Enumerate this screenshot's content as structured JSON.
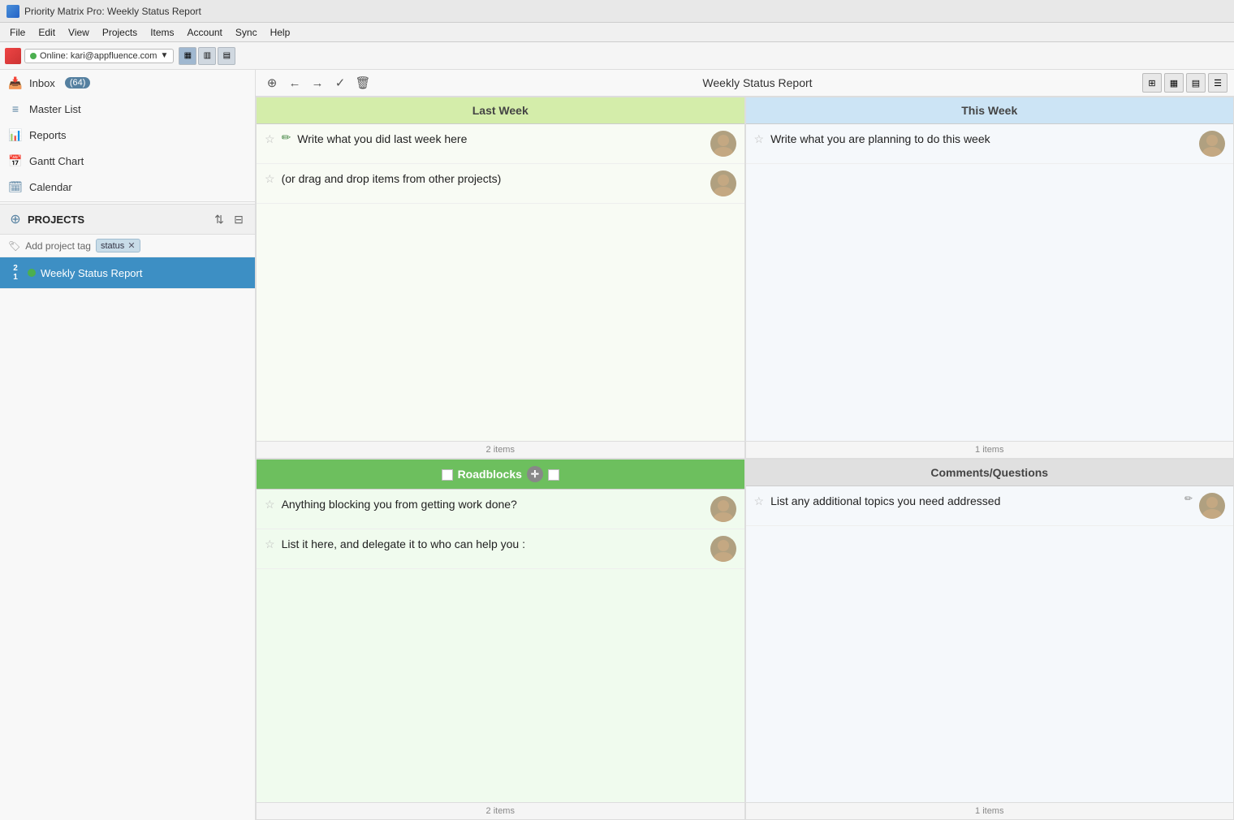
{
  "titlebar": {
    "app_icon": "pm-icon",
    "title": "Priority Matrix Pro: Weekly Status Report"
  },
  "menubar": {
    "items": [
      "File",
      "Edit",
      "View",
      "Projects",
      "Items",
      "Account",
      "Sync",
      "Help"
    ]
  },
  "toolbar": {
    "online_label": "Online: kari@appfluence.com",
    "dropdown_arrow": "▼"
  },
  "sidebar": {
    "inbox_label": "Inbox",
    "inbox_count": "(64)",
    "master_list_label": "Master List",
    "reports_label": "Reports",
    "gantt_label": "Gantt Chart",
    "calendar_label": "Calendar",
    "projects_label": "PROJECTS",
    "add_project_tag_label": "Add project tag",
    "tag_name": "status",
    "tag_x": "✕",
    "project": {
      "name": "Weekly Status Report",
      "num_top": "2",
      "num_bottom": "1"
    }
  },
  "report": {
    "title": "Weekly Status Report",
    "quadrants": {
      "last_week": {
        "header": "Last Week",
        "items": [
          {
            "star": "☆",
            "pencil": "✏",
            "text": "Write what you did last week here",
            "has_avatar": true
          },
          {
            "star": "☆",
            "text": "(or drag and drop items from other projects)",
            "has_avatar": true
          }
        ],
        "footer_count": "2 items"
      },
      "this_week": {
        "header": "This Week",
        "items": [
          {
            "star": "☆",
            "text": "Write what you are planning to do this week",
            "has_avatar": true
          }
        ],
        "footer_count": "1 items"
      },
      "roadblocks": {
        "header": "Roadblocks",
        "items": [
          {
            "star": "☆",
            "text": "Anything blocking you from getting work done?",
            "has_avatar": true
          },
          {
            "star": "☆",
            "text": "List it here, and delegate it to who can help you :",
            "has_avatar": true
          }
        ],
        "footer_count": "2 items"
      },
      "comments": {
        "header": "Comments/Questions",
        "items": [
          {
            "star": "☆",
            "text": "List any additional topics you need addressed",
            "has_avatar": true,
            "pencil": "✏"
          }
        ],
        "footer_count": "1 items"
      }
    }
  }
}
